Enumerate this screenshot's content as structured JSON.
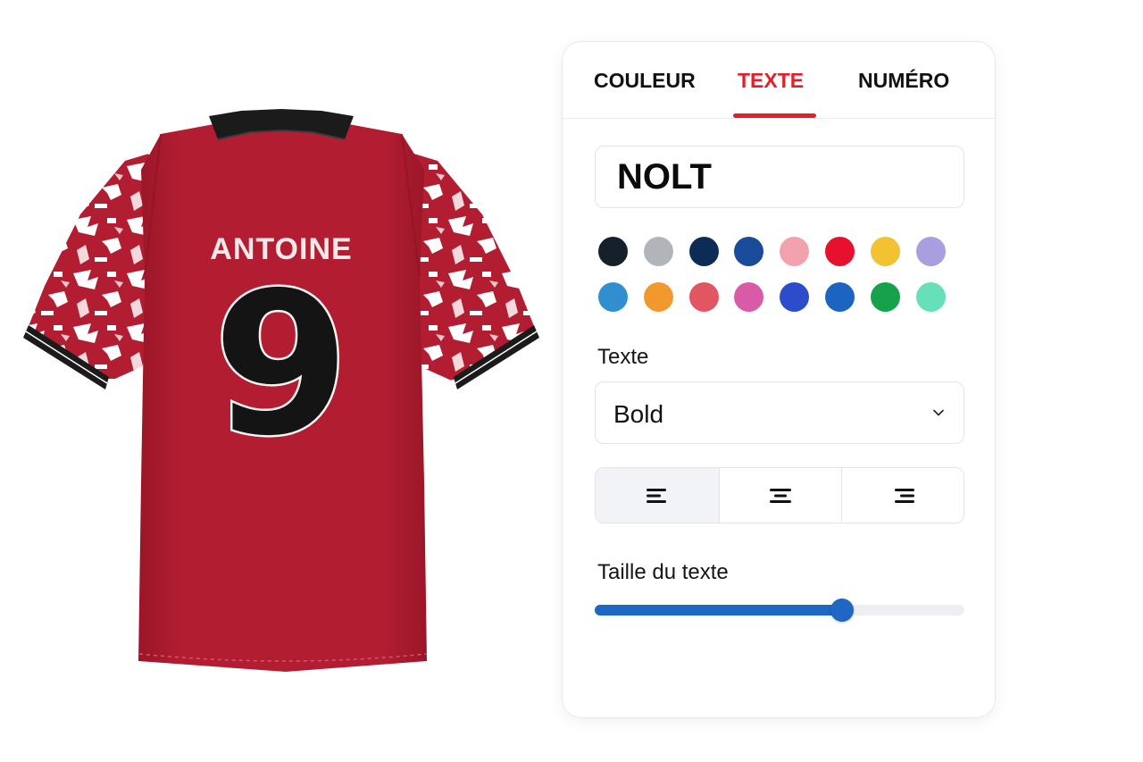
{
  "jersey": {
    "player_name": "ANTOINE",
    "player_number": "9",
    "body_color": "#b31d32",
    "collar_color": "#1b1b1b",
    "sleeve_pattern_colors": [
      "#b31d32",
      "#ffffff"
    ]
  },
  "panel": {
    "tabs": [
      {
        "label": "COULEUR",
        "active": false
      },
      {
        "label": "TEXTE",
        "active": true
      },
      {
        "label": "NUMÉRO",
        "active": false
      }
    ],
    "text_input": {
      "value": "NOLT"
    },
    "color_swatches": [
      "#15202b",
      "#b1b5ba",
      "#0d2c55",
      "#1a4a9a",
      "#f3a1ad",
      "#e8112d",
      "#f2c230",
      "#a79fe0",
      "#2f8fcf",
      "#f2992e",
      "#e25563",
      "#d95aa6",
      "#2d4ccc",
      "#1b64c2",
      "#16a24a",
      "#65e0b9"
    ],
    "font_label": "Texte",
    "font_select": {
      "value": "Bold"
    },
    "alignment": {
      "options": [
        "align-left",
        "align-center",
        "align-right"
      ],
      "selected": "align-left"
    },
    "size_label": "Taille du texte",
    "size_slider": {
      "value_fraction": 0.67
    },
    "accent_color": "#e0212c",
    "slider_color": "#1f67c5"
  }
}
